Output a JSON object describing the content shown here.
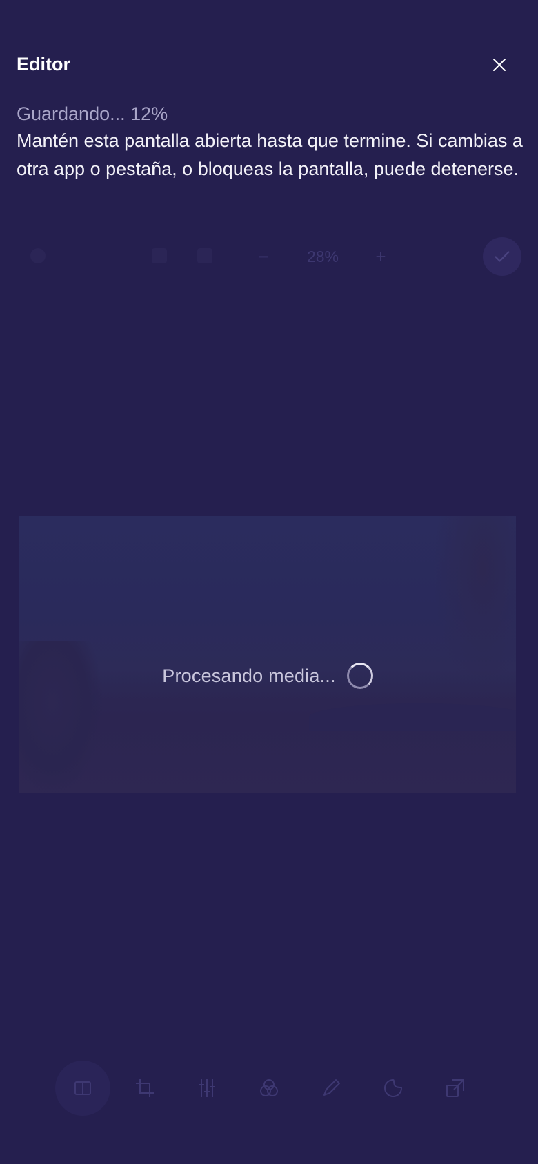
{
  "header": {
    "title": "Editor",
    "close_icon": "close-icon"
  },
  "saving": {
    "progress_label": "Guardando... 12%",
    "progress_percent": 12,
    "message": "Mantén esta pantalla abierta hasta que termine. Si cambias a otra app o pestaña, o bloqueas la pantalla, puede detenerse."
  },
  "zoom": {
    "minus_label": "−",
    "value": "28%",
    "plus_label": "+"
  },
  "media": {
    "processing_label": "Procesando media..."
  },
  "toolbar": {
    "tools": [
      {
        "icon": "media-icon",
        "active": true
      },
      {
        "icon": "crop-icon",
        "active": false
      },
      {
        "icon": "adjust-sliders-icon",
        "active": false
      },
      {
        "icon": "filters-icon",
        "active": false
      },
      {
        "icon": "draw-pencil-icon",
        "active": false
      },
      {
        "icon": "sticker-icon",
        "active": false
      },
      {
        "icon": "resize-icon",
        "active": false
      }
    ]
  },
  "colors": {
    "background": "#251f4f",
    "text_primary": "#ffffff",
    "text_secondary": "#a9a5c8",
    "dimmed_control": "#3d3770"
  }
}
